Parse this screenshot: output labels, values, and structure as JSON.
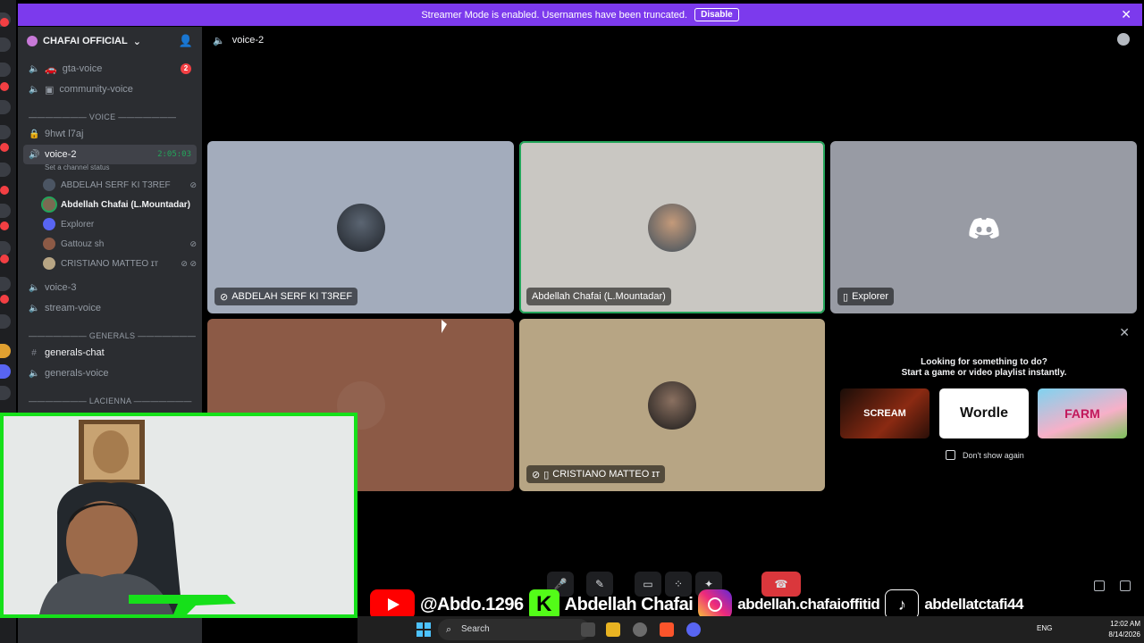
{
  "banner": {
    "text": "Streamer Mode is enabled. Usernames have been truncated.",
    "disable_label": "Disable"
  },
  "server": {
    "name": "CHAFAI OFFICIAL"
  },
  "channels": {
    "gta": {
      "name": "gta-voice",
      "badge": "2"
    },
    "community": {
      "name": "community-voice"
    },
    "voice_category": "——————— VOICE ———————",
    "locked": {
      "name": "9hwt l7aj"
    },
    "voice2": {
      "name": "voice-2",
      "timer": "2:05:03",
      "status": "Set a channel status"
    },
    "voice3": {
      "name": "voice-3"
    },
    "stream": {
      "name": "stream-voice"
    },
    "generals_category": "——————— GENERALS ———————",
    "generals_chat": {
      "name": "generals-chat"
    },
    "generals_voice": {
      "name": "generals-voice"
    },
    "lacienna_category": "——————— LACIENNA ———————"
  },
  "members": [
    {
      "name": "ABDELAH SERF KI T3REF"
    },
    {
      "name": "Abdellah Chafai (L.Mountadar)"
    },
    {
      "name": "Explorer"
    },
    {
      "name": "Gattouz sh"
    },
    {
      "name": "CRISTIANO MATTEO ɪᴛ"
    }
  ],
  "topbar": {
    "channel": "voice-2"
  },
  "tiles": [
    {
      "label": "ABDELAH SERF KI T3REF",
      "color": "#a3acbc"
    },
    {
      "label": "Abdellah Chafai (L.Mountadar)",
      "color": "#c9c7c2"
    },
    {
      "label": "Explorer",
      "color": "#989ba4"
    },
    {
      "label": "",
      "color": "#8c5a46"
    },
    {
      "label": "CRISTIANO MATTEO ɪᴛ",
      "color": "#b7a584"
    }
  ],
  "activity": {
    "line1": "Looking for something to do?",
    "line2": "Start a game or video playlist instantly.",
    "games": [
      "SCREAM",
      "Wordle",
      "FARM"
    ],
    "dont_show": "Don't show again"
  },
  "social": {
    "youtube": "@Abdo.1296",
    "kick": "Abdellah Chafai",
    "instagram": "abdellah.chafaioffitid",
    "tiktok": "abdellatctafi44"
  },
  "taskbar": {
    "search_placeholder": "Search",
    "lang": "ENG",
    "time": "12:02 AM",
    "date": "8/14/2026"
  },
  "colors": {
    "accent": "#7c3aed",
    "speaking": "#23a55a",
    "webcam_border": "#16e01a"
  }
}
